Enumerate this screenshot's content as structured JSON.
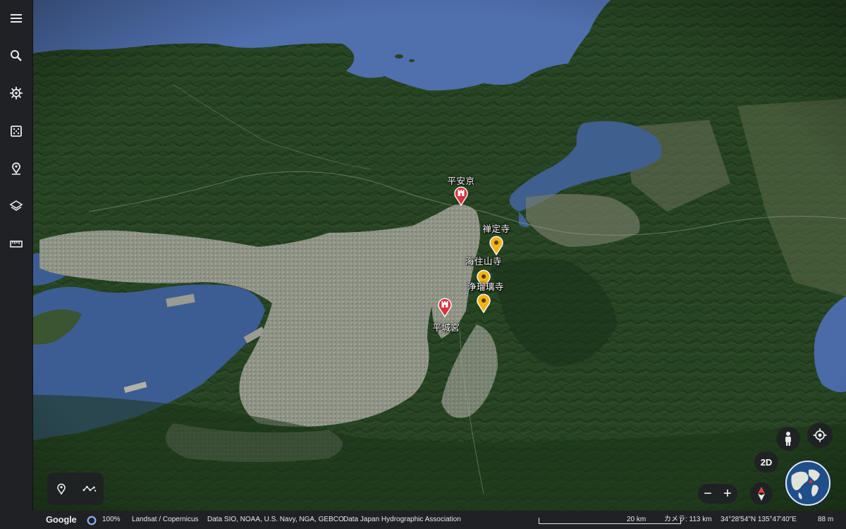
{
  "sidebar": {
    "items": [
      {
        "name": "menu",
        "icon": "menu-icon"
      },
      {
        "name": "search",
        "icon": "search-icon"
      },
      {
        "name": "voyager",
        "icon": "voyager-helm-icon"
      },
      {
        "name": "feeling-lucky",
        "icon": "dice-icon"
      },
      {
        "name": "projects",
        "icon": "projects-pin-icon"
      },
      {
        "name": "map-style",
        "icon": "layers-icon"
      },
      {
        "name": "measure",
        "icon": "ruler-icon"
      }
    ]
  },
  "places": [
    {
      "label": "平安京",
      "type": "red-castle"
    },
    {
      "label": "禅定寺",
      "type": "yellow-pin"
    },
    {
      "label": "海住山寺",
      "type": "yellow-pin"
    },
    {
      "label": "浄瑠璃寺",
      "type": "yellow-pin"
    },
    {
      "label": "平城宮",
      "type": "red-castle"
    }
  ],
  "controls": {
    "view_2d_label": "2D",
    "zoom_out": "−",
    "zoom_in": "+"
  },
  "statusbar": {
    "logo": "Google",
    "render_percent": "100%",
    "attribution_1": "Landsat / Copernicus",
    "attribution_2": "Data SIO, NOAA, U.S. Navy, NGA, GEBCO",
    "attribution_3": "Data Japan Hydrographic Association",
    "scale": "20 km",
    "camera": "カメラ: 113 km",
    "coordinates": "34°28'54\"N 135°47'40\"E",
    "elevation": "88 m"
  },
  "colors": {
    "water": "#4a6aa8",
    "forest": "#1f3b1c",
    "urban": "#8d9183",
    "pin_yellow": "#f2b31a",
    "pin_red": "#d8323b",
    "toolbar_bg": "#202124"
  }
}
